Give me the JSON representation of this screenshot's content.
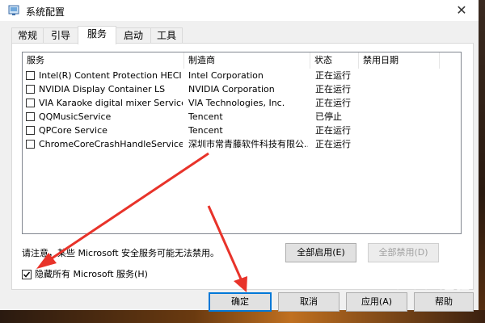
{
  "window": {
    "title": "系统配置",
    "close_glyph": "✕"
  },
  "tabs": [
    {
      "label": "常规",
      "active": false
    },
    {
      "label": "引导",
      "active": false
    },
    {
      "label": "服务",
      "active": true
    },
    {
      "label": "启动",
      "active": false
    },
    {
      "label": "工具",
      "active": false
    }
  ],
  "columns": {
    "service": "服务",
    "manufacturer": "制造商",
    "status": "状态",
    "disabled_date": "禁用日期"
  },
  "services": [
    {
      "name": "Intel(R) Content Protection HECI ...",
      "manufacturer": "Intel Corporation",
      "status": "正在运行",
      "checked": false
    },
    {
      "name": "NVIDIA Display Container LS",
      "manufacturer": "NVIDIA Corporation",
      "status": "正在运行",
      "checked": false
    },
    {
      "name": "VIA Karaoke digital mixer Service",
      "manufacturer": "VIA Technologies, Inc.",
      "status": "正在运行",
      "checked": false
    },
    {
      "name": "QQMusicService",
      "manufacturer": "Tencent",
      "status": "已停止",
      "checked": false
    },
    {
      "name": "QPCore Service",
      "manufacturer": "Tencent",
      "status": "正在运行",
      "checked": false
    },
    {
      "name": "ChromeCoreCrashHandleService",
      "manufacturer": "深圳市常青藤软件科技有限公...",
      "status": "正在运行",
      "checked": false
    }
  ],
  "note": "请注意，某些 Microsoft 安全服务可能无法禁用。",
  "enable_all_label": "全部启用(E)",
  "disable_all_label": "全部禁用(D)",
  "hide_ms_label": "隐藏所有 Microsoft 服务(H)",
  "hide_ms_checked": true,
  "buttons": {
    "ok": "确定",
    "cancel": "取消",
    "apply": "应用(A)",
    "help": "帮助"
  },
  "watermark": "Baidu 经验",
  "annotation_color": "#e8332a"
}
